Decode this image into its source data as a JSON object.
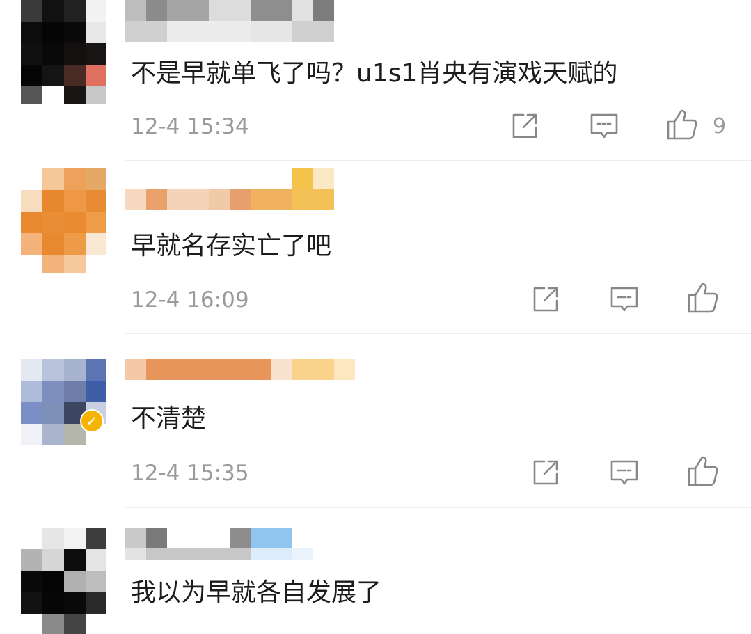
{
  "comments": [
    {
      "text": "不是早就单飞了吗？u1s1肖央有演戏天赋的",
      "time": "12-4 15:34",
      "like_count": "9",
      "verified": false
    },
    {
      "text": "早就名存实亡了吧",
      "time": "12-4 16:09",
      "like_count": "",
      "verified": false
    },
    {
      "text": "不清楚",
      "time": "12-4 15:35",
      "like_count": "",
      "verified": true
    },
    {
      "text": "我以为早就各自发展了",
      "time": "",
      "like_count": "",
      "verified": false
    }
  ],
  "icons": {
    "share": "share-icon",
    "reply": "comment-icon",
    "like": "thumbs-up-icon",
    "verified": "verified-badge-icon"
  },
  "colors": {
    "text": "#1c1c1c",
    "meta": "#9a9a9a",
    "divider": "#ececec",
    "verified": "#f5b400"
  }
}
